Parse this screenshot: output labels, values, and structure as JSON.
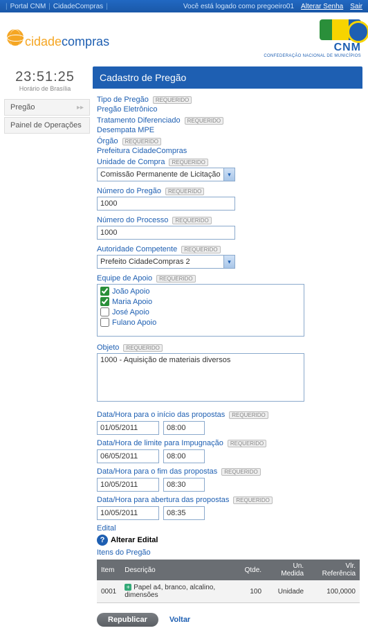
{
  "topbar": {
    "crumb1": "Portal CNM",
    "crumb2": "CidadeCompras",
    "logged_text": "Você está logado como pregoeiro01",
    "link_alterar": "Alterar Senha",
    "link_sair": "Sair"
  },
  "logo": {
    "word1": "cidade",
    "word2": "compras"
  },
  "cnm": {
    "big": "CNM",
    "sub": "CONFEDERAÇÃO NACIONAL DE MUNICÍPIOS"
  },
  "clock": {
    "time": "23:51:25",
    "sub": "Horário de Brasília"
  },
  "sidebar": {
    "items": [
      {
        "label": "Pregão"
      },
      {
        "label": "Painel de Operações"
      }
    ]
  },
  "panel": {
    "title": "Cadastro de Pregão"
  },
  "badges": {
    "required": "REQUERIDO"
  },
  "labels": {
    "tipo_pregao": "Tipo de Pregão",
    "tipo_pregao_val": "Pregão Eletrônico",
    "tratamento": "Tratamento Diferenciado",
    "tratamento_val": "Desempata MPE",
    "orgao": "Órgão",
    "orgao_val": "Prefeitura CidadeCompras",
    "unidade": "Unidade de Compra",
    "unidade_val": "Comissão Permanente de Licitação",
    "num_pregao": "Número do Pregão",
    "num_pregao_val": "1000",
    "num_processo": "Número do Processo",
    "num_processo_val": "1000",
    "autoridade": "Autoridade Competente",
    "autoridade_val": "Prefeito CidadeCompras 2",
    "equipe": "Equipe de Apoio",
    "objeto": "Objeto",
    "objeto_val": "1000 - Aquisição de materiais diversos",
    "dh_inicio": "Data/Hora para o início das propostas",
    "dh_impug": "Data/Hora de limite para Impugnação",
    "dh_fim": "Data/Hora para o fim das propostas",
    "dh_abertura": "Data/Hora para abertura das propostas",
    "edital": "Edital",
    "alterar_edital": "Alterar Edital",
    "itens": "Itens do Pregão"
  },
  "equipe_options": [
    {
      "label": "João Apoio",
      "checked": true
    },
    {
      "label": "Maria Apoio",
      "checked": true
    },
    {
      "label": "José Apoio",
      "checked": false
    },
    {
      "label": "Fulano Apoio",
      "checked": false
    }
  ],
  "dates": {
    "inicio_d": "01/05/2011",
    "inicio_t": "08:00",
    "impug_d": "06/05/2011",
    "impug_t": "08:00",
    "fim_d": "10/05/2011",
    "fim_t": "08:30",
    "abert_d": "10/05/2011",
    "abert_t": "08:35"
  },
  "table": {
    "headers": {
      "item": "Item",
      "desc": "Descrição",
      "qtde": "Qtde.",
      "un": "Un. Medida",
      "vlr": "Vlr. Referência"
    },
    "rows": [
      {
        "item": "0001",
        "desc": "Papel a4, branco, alcalino, dimensões",
        "qtde": "100",
        "un": "Unidade",
        "vlr": "100,0000"
      }
    ]
  },
  "buttons": {
    "republicar": "Republicar",
    "voltar": "Voltar"
  }
}
